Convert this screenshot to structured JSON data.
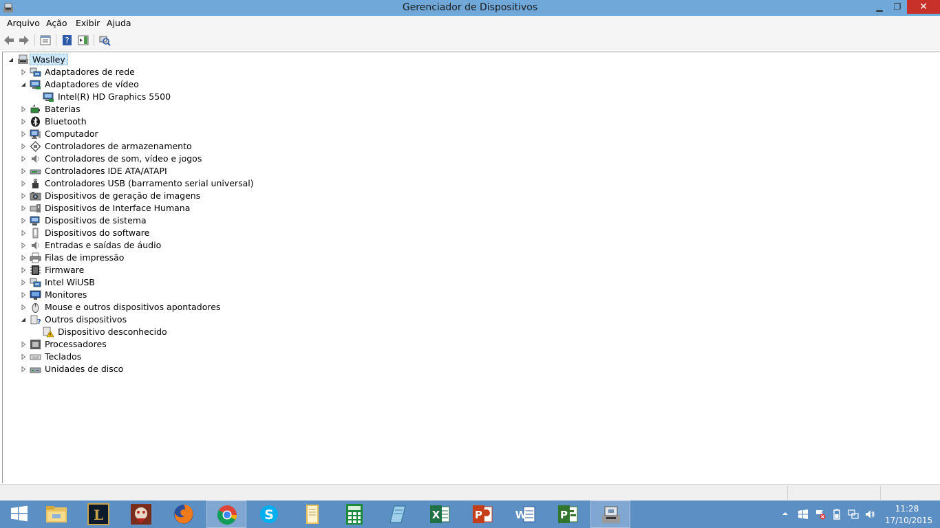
{
  "window": {
    "title": "Gerenciador de Dispositivos",
    "minimize": "▁",
    "maximize": "❐",
    "close": "✕"
  },
  "menu": [
    "Arquivo",
    "Ação",
    "Exibir",
    "Ajuda"
  ],
  "tree": {
    "root": "Waslley",
    "categories": [
      {
        "label": "Adaptadores de rede",
        "icon": "network-adapter-icon",
        "expanded": false
      },
      {
        "label": "Adaptadores de vídeo",
        "icon": "display-adapter-icon",
        "expanded": true,
        "children": [
          {
            "label": "Intel(R) HD Graphics 5500",
            "icon": "display-adapter-icon"
          }
        ]
      },
      {
        "label": "Baterias",
        "icon": "battery-icon",
        "expanded": false
      },
      {
        "label": "Bluetooth",
        "icon": "bluetooth-icon",
        "expanded": false
      },
      {
        "label": "Computador",
        "icon": "computer-icon",
        "expanded": false
      },
      {
        "label": "Controladores de armazenamento",
        "icon": "storage-controller-icon",
        "expanded": false
      },
      {
        "label": "Controladores de som, vídeo e jogos",
        "icon": "speaker-icon",
        "expanded": false
      },
      {
        "label": "Controladores IDE ATA/ATAPI",
        "icon": "ide-controller-icon",
        "expanded": false
      },
      {
        "label": "Controladores USB (barramento serial universal)",
        "icon": "usb-icon",
        "expanded": false
      },
      {
        "label": "Dispositivos de geração de imagens",
        "icon": "camera-icon",
        "expanded": false
      },
      {
        "label": "Dispositivos de Interface Humana",
        "icon": "hid-icon",
        "expanded": false
      },
      {
        "label": "Dispositivos de sistema",
        "icon": "system-device-icon",
        "expanded": false
      },
      {
        "label": "Dispositivos do software",
        "icon": "software-device-icon",
        "expanded": false
      },
      {
        "label": "Entradas e saídas de áudio",
        "icon": "speaker-icon",
        "expanded": false
      },
      {
        "label": "Filas de impressão",
        "icon": "printer-icon",
        "expanded": false
      },
      {
        "label": "Firmware",
        "icon": "chip-icon",
        "expanded": false
      },
      {
        "label": "Intel WiUSB",
        "icon": "network-adapter-icon",
        "expanded": false
      },
      {
        "label": "Monitores",
        "icon": "monitor-icon",
        "expanded": false
      },
      {
        "label": "Mouse e outros dispositivos apontadores",
        "icon": "mouse-icon",
        "expanded": false
      },
      {
        "label": "Outros dispositivos",
        "icon": "unknown-device-icon",
        "expanded": true,
        "children": [
          {
            "label": "Dispositivo desconhecido",
            "icon": "warning-device-icon"
          }
        ]
      },
      {
        "label": "Processadores",
        "icon": "processor-icon",
        "expanded": false
      },
      {
        "label": "Teclados",
        "icon": "keyboard-icon",
        "expanded": false
      },
      {
        "label": "Unidades de disco",
        "icon": "disk-drive-icon",
        "expanded": false
      }
    ]
  },
  "taskbar": {
    "apps": [
      "start-button",
      "file-explorer",
      "league-of-legends",
      "game-app",
      "firefox",
      "chrome",
      "skype",
      "folder-docs",
      "calculator",
      "notes-app",
      "excel",
      "powerpoint",
      "word",
      "project",
      "device-manager"
    ],
    "clock_time": "11:28",
    "clock_date": "17/10/2015"
  },
  "colors": {
    "titlebar": "#6fa8d9",
    "close_button": "#c7312a",
    "taskbar": "#5c8fc4",
    "selection": "#cce8ff"
  }
}
